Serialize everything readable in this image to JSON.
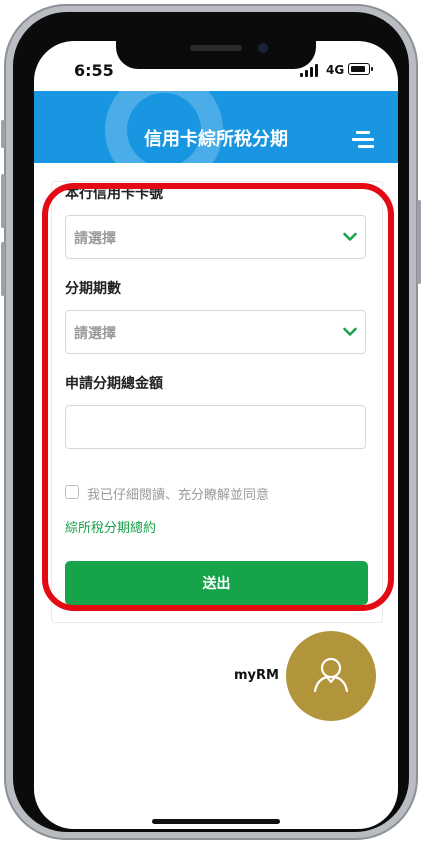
{
  "status_bar": {
    "time": "6:55",
    "network": "4G"
  },
  "header": {
    "title": "信用卡綜所稅分期",
    "menu_icon": "hamburger-menu-icon",
    "background_color": "#1896e2"
  },
  "form": {
    "card_number": {
      "label": "本行信用卡卡號",
      "placeholder": "請選擇"
    },
    "installments": {
      "label": "分期期數",
      "placeholder": "請選擇"
    },
    "amount": {
      "label": "申請分期總金額",
      "value": ""
    },
    "agreement": {
      "checkbox_label": "我已仔細閱讀、充分瞭解並同意",
      "checked": false,
      "link_text": "綜所稅分期總約"
    },
    "submit_label": "送出"
  },
  "myrm": {
    "label": "myRM",
    "icon": "person-icon"
  },
  "colors": {
    "accent_green": "#17a34a",
    "highlight_red": "#e30a14",
    "myrm_gold": "#b2953a"
  }
}
